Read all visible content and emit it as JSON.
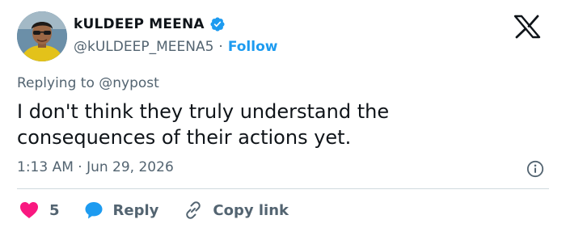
{
  "author": {
    "display_name": "kULDEEP MEENA",
    "handle": "@kULDEEP_MEENA5",
    "separator": "·",
    "follow_label": "Follow",
    "verified": true
  },
  "tweet": {
    "replying_to": "Replying to @nypost",
    "text": "I don't think they truly understand the consequences of their actions yet.",
    "timestamp": "1:13 AM · Jun 29, 2026"
  },
  "actions": {
    "like_count": "5",
    "reply_label": "Reply",
    "copy_link_label": "Copy link"
  },
  "icons": {
    "brand": "x-logo-icon",
    "verified": "verified-badge-icon",
    "info": "info-icon",
    "like": "heart-icon",
    "reply": "speech-bubble-icon",
    "copy": "link-icon"
  },
  "colors": {
    "accent": "#1d9bf0",
    "like": "#f91880",
    "text_primary": "#0f1419",
    "text_secondary": "#536471",
    "divider": "#cfd9de"
  }
}
